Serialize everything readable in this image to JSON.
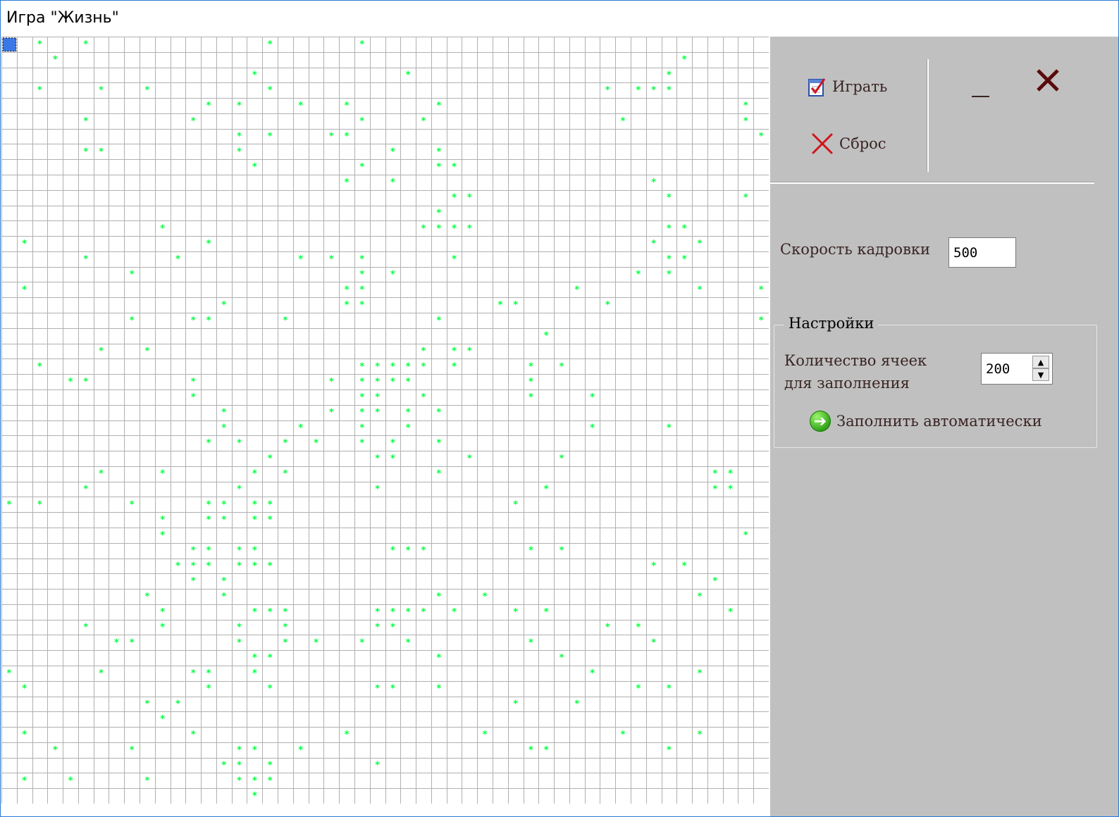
{
  "window": {
    "title": "Игра \"Жизнь\""
  },
  "grid": {
    "rows": 50,
    "cols": 50,
    "cell_color": "#00ff40",
    "line_color": "#b0b0b0",
    "live_cells": [
      [
        0,
        2
      ],
      [
        0,
        5
      ],
      [
        0,
        17
      ],
      [
        0,
        23
      ],
      [
        1,
        3
      ],
      [
        1,
        44
      ],
      [
        2,
        16
      ],
      [
        2,
        26
      ],
      [
        2,
        43
      ],
      [
        3,
        2
      ],
      [
        3,
        6
      ],
      [
        3,
        9
      ],
      [
        3,
        17
      ],
      [
        3,
        39
      ],
      [
        3,
        41
      ],
      [
        3,
        42
      ],
      [
        3,
        43
      ],
      [
        4,
        13
      ],
      [
        4,
        15
      ],
      [
        4,
        19
      ],
      [
        4,
        22
      ],
      [
        4,
        28
      ],
      [
        4,
        48
      ],
      [
        5,
        5
      ],
      [
        5,
        12
      ],
      [
        5,
        23
      ],
      [
        5,
        27
      ],
      [
        5,
        40
      ],
      [
        5,
        48
      ],
      [
        6,
        15
      ],
      [
        6,
        17
      ],
      [
        6,
        21
      ],
      [
        6,
        22
      ],
      [
        6,
        49
      ],
      [
        7,
        5
      ],
      [
        7,
        6
      ],
      [
        7,
        15
      ],
      [
        7,
        25
      ],
      [
        7,
        28
      ],
      [
        8,
        16
      ],
      [
        8,
        23
      ],
      [
        8,
        28
      ],
      [
        8,
        29
      ],
      [
        9,
        22
      ],
      [
        9,
        25
      ],
      [
        9,
        42
      ],
      [
        10,
        29
      ],
      [
        10,
        30
      ],
      [
        10,
        43
      ],
      [
        10,
        48
      ],
      [
        11,
        28
      ],
      [
        12,
        10
      ],
      [
        12,
        27
      ],
      [
        12,
        28
      ],
      [
        12,
        29
      ],
      [
        12,
        30
      ],
      [
        12,
        43
      ],
      [
        12,
        44
      ],
      [
        13,
        1
      ],
      [
        13,
        13
      ],
      [
        13,
        42
      ],
      [
        13,
        45
      ],
      [
        14,
        5
      ],
      [
        14,
        11
      ],
      [
        14,
        19
      ],
      [
        14,
        21
      ],
      [
        14,
        23
      ],
      [
        14,
        29
      ],
      [
        14,
        43
      ],
      [
        14,
        44
      ],
      [
        15,
        8
      ],
      [
        15,
        23
      ],
      [
        15,
        25
      ],
      [
        15,
        41
      ],
      [
        15,
        43
      ],
      [
        16,
        1
      ],
      [
        16,
        22
      ],
      [
        16,
        23
      ],
      [
        16,
        37
      ],
      [
        16,
        45
      ],
      [
        16,
        49
      ],
      [
        17,
        14
      ],
      [
        17,
        22
      ],
      [
        17,
        23
      ],
      [
        17,
        32
      ],
      [
        17,
        33
      ],
      [
        17,
        39
      ],
      [
        18,
        8
      ],
      [
        18,
        12
      ],
      [
        18,
        13
      ],
      [
        18,
        18
      ],
      [
        18,
        28
      ],
      [
        18,
        49
      ],
      [
        19,
        35
      ],
      [
        20,
        6
      ],
      [
        20,
        9
      ],
      [
        20,
        27
      ],
      [
        20,
        29
      ],
      [
        20,
        30
      ],
      [
        21,
        2
      ],
      [
        21,
        23
      ],
      [
        21,
        24
      ],
      [
        21,
        25
      ],
      [
        21,
        26
      ],
      [
        21,
        27
      ],
      [
        21,
        29
      ],
      [
        21,
        34
      ],
      [
        21,
        36
      ],
      [
        22,
        4
      ],
      [
        22,
        5
      ],
      [
        22,
        12
      ],
      [
        22,
        21
      ],
      [
        22,
        23
      ],
      [
        22,
        24
      ],
      [
        22,
        25
      ],
      [
        22,
        26
      ],
      [
        22,
        34
      ],
      [
        23,
        12
      ],
      [
        23,
        23
      ],
      [
        23,
        24
      ],
      [
        23,
        27
      ],
      [
        23,
        34
      ],
      [
        23,
        38
      ],
      [
        24,
        14
      ],
      [
        24,
        21
      ],
      [
        24,
        23
      ],
      [
        24,
        24
      ],
      [
        24,
        26
      ],
      [
        24,
        28
      ],
      [
        25,
        14
      ],
      [
        25,
        19
      ],
      [
        25,
        23
      ],
      [
        25,
        26
      ],
      [
        25,
        38
      ],
      [
        25,
        43
      ],
      [
        26,
        13
      ],
      [
        26,
        15
      ],
      [
        26,
        18
      ],
      [
        26,
        20
      ],
      [
        26,
        23
      ],
      [
        26,
        25
      ],
      [
        26,
        28
      ],
      [
        27,
        17
      ],
      [
        27,
        24
      ],
      [
        27,
        25
      ],
      [
        27,
        30
      ],
      [
        27,
        36
      ],
      [
        28,
        6
      ],
      [
        28,
        10
      ],
      [
        28,
        16
      ],
      [
        28,
        18
      ],
      [
        28,
        28
      ],
      [
        28,
        46
      ],
      [
        28,
        47
      ],
      [
        29,
        5
      ],
      [
        29,
        15
      ],
      [
        29,
        24
      ],
      [
        29,
        35
      ],
      [
        29,
        46
      ],
      [
        29,
        47
      ],
      [
        30,
        0
      ],
      [
        30,
        2
      ],
      [
        30,
        8
      ],
      [
        30,
        13
      ],
      [
        30,
        14
      ],
      [
        30,
        16
      ],
      [
        30,
        17
      ],
      [
        30,
        33
      ],
      [
        31,
        10
      ],
      [
        31,
        13
      ],
      [
        31,
        14
      ],
      [
        31,
        16
      ],
      [
        31,
        17
      ],
      [
        32,
        10
      ],
      [
        32,
        48
      ],
      [
        33,
        12
      ],
      [
        33,
        13
      ],
      [
        33,
        15
      ],
      [
        33,
        16
      ],
      [
        33,
        25
      ],
      [
        33,
        26
      ],
      [
        33,
        27
      ],
      [
        33,
        34
      ],
      [
        33,
        36
      ],
      [
        34,
        11
      ],
      [
        34,
        12
      ],
      [
        34,
        13
      ],
      [
        34,
        15
      ],
      [
        34,
        16
      ],
      [
        34,
        17
      ],
      [
        34,
        42
      ],
      [
        34,
        44
      ],
      [
        35,
        12
      ],
      [
        35,
        14
      ],
      [
        35,
        46
      ],
      [
        36,
        9
      ],
      [
        36,
        14
      ],
      [
        36,
        28
      ],
      [
        36,
        31
      ],
      [
        36,
        45
      ],
      [
        37,
        10
      ],
      [
        37,
        16
      ],
      [
        37,
        17
      ],
      [
        37,
        18
      ],
      [
        37,
        24
      ],
      [
        37,
        25
      ],
      [
        37,
        26
      ],
      [
        37,
        27
      ],
      [
        37,
        29
      ],
      [
        37,
        33
      ],
      [
        37,
        35
      ],
      [
        37,
        47
      ],
      [
        38,
        5
      ],
      [
        38,
        10
      ],
      [
        38,
        15
      ],
      [
        38,
        18
      ],
      [
        38,
        24
      ],
      [
        38,
        25
      ],
      [
        38,
        39
      ],
      [
        38,
        41
      ],
      [
        39,
        7
      ],
      [
        39,
        8
      ],
      [
        39,
        15
      ],
      [
        39,
        18
      ],
      [
        39,
        20
      ],
      [
        39,
        23
      ],
      [
        39,
        26
      ],
      [
        39,
        34
      ],
      [
        39,
        42
      ],
      [
        40,
        16
      ],
      [
        40,
        17
      ],
      [
        40,
        28
      ],
      [
        40,
        36
      ],
      [
        41,
        0
      ],
      [
        41,
        6
      ],
      [
        41,
        12
      ],
      [
        41,
        13
      ],
      [
        41,
        16
      ],
      [
        41,
        38
      ],
      [
        41,
        45
      ],
      [
        42,
        1
      ],
      [
        42,
        13
      ],
      [
        42,
        17
      ],
      [
        42,
        24
      ],
      [
        42,
        25
      ],
      [
        42,
        28
      ],
      [
        42,
        41
      ],
      [
        42,
        43
      ],
      [
        43,
        9
      ],
      [
        43,
        11
      ],
      [
        43,
        33
      ],
      [
        43,
        37
      ],
      [
        44,
        10
      ],
      [
        45,
        1
      ],
      [
        45,
        12
      ],
      [
        45,
        22
      ],
      [
        45,
        31
      ],
      [
        45,
        40
      ],
      [
        45,
        45
      ],
      [
        46,
        3
      ],
      [
        46,
        8
      ],
      [
        46,
        15
      ],
      [
        46,
        16
      ],
      [
        46,
        19
      ],
      [
        46,
        34
      ],
      [
        46,
        35
      ],
      [
        46,
        43
      ],
      [
        47,
        14
      ],
      [
        47,
        15
      ],
      [
        47,
        17
      ],
      [
        47,
        24
      ],
      [
        48,
        1
      ],
      [
        48,
        4
      ],
      [
        48,
        9
      ],
      [
        48,
        15
      ],
      [
        48,
        16
      ],
      [
        48,
        17
      ],
      [
        49,
        16
      ]
    ]
  },
  "toolbar": {
    "play_label": "Играть",
    "reset_label": "Сброс",
    "play_icon": "checklist-icon",
    "reset_icon": "red-x-icon",
    "minimize_icon": "minimize-icon",
    "close_icon": "close-icon",
    "accent_dark_red": "#5a0a0a"
  },
  "speed": {
    "label": "Скорость кадровки",
    "value": "500"
  },
  "settings": {
    "title": "Настройки",
    "count_label_line1": "Количество ячеек",
    "count_label_line2": "для заполнения",
    "count_value": "200",
    "fill_label": "Заполнить автоматически",
    "fill_icon": "green-arrow-icon"
  }
}
